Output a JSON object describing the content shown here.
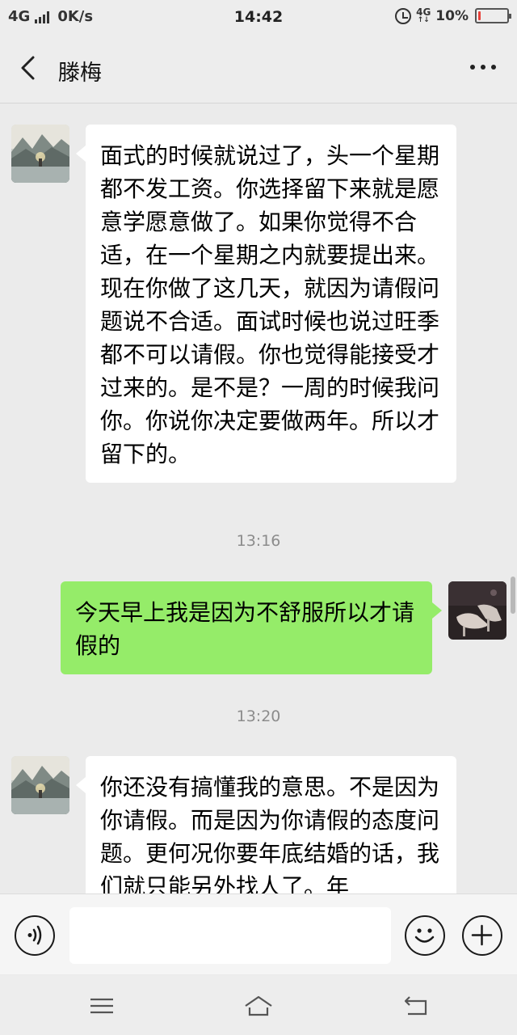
{
  "status_bar": {
    "network": "4G",
    "speed": "0K/s",
    "time": "14:42",
    "net_badge_top": "4G",
    "net_badge_bottom": "↑↓",
    "battery": "10%",
    "battery_level": 0.1,
    "battery_color": "#e8413a",
    "icons": [
      "signal-bars-icon",
      "alarm-clock-icon",
      "battery-icon"
    ]
  },
  "header": {
    "title": "滕梅",
    "back_icon": "chevron-left-icon",
    "more_icon": "more-dots-icon"
  },
  "messages": [
    {
      "sender": "contact",
      "avatar": "landscape-avatar",
      "text": "面式的时候就说过了，头一个星期都不发工资。你选择留下来就是愿意学愿意做了。如果你觉得不合适，在一个星期之内就要提出来。现在你做了这几天，就因为请假问题说不合适。面试时候也说过旺季都不可以请假。你也觉得能接受才过来的。是不是？一周的时候我问你。你说你决定要做两年。所以才留下的。"
    },
    {
      "timestamp": "13:16"
    },
    {
      "sender": "self",
      "avatar": "shoes-avatar",
      "text": "今天早上我是因为不舒服所以才请假的"
    },
    {
      "timestamp": "13:20"
    },
    {
      "sender": "contact",
      "avatar": "landscape-avatar",
      "text": "你还没有搞懂我的意思。不是因为你请假。而是因为你请假的态度问题。更何况你要年底结婚的话，我们就只能另外找人了。年"
    }
  ],
  "input_bar": {
    "value": "",
    "icons": [
      "voice-icon",
      "emoji-icon",
      "plus-icon"
    ]
  },
  "nav_bar": {
    "icons": [
      "menu-icon",
      "home-icon",
      "back-icon"
    ]
  },
  "colors": {
    "outgoing_bubble": "#95ec69",
    "incoming_bubble": "#ffffff",
    "background": "#ebebeb"
  }
}
